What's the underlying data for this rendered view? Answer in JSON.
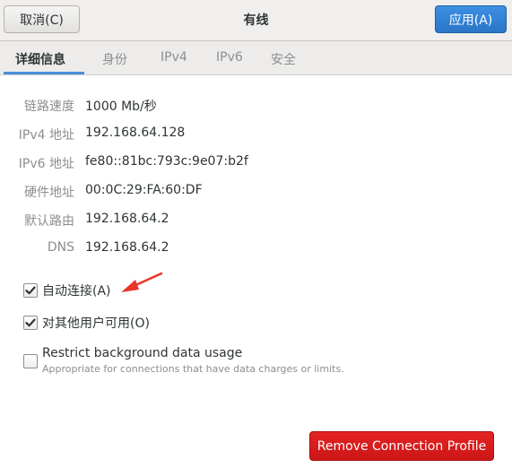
{
  "header": {
    "cancel_label": "取消(C)",
    "title": "有线",
    "apply_label": "应用(A)"
  },
  "tabs": [
    {
      "label": "详细信息",
      "active": true
    },
    {
      "label": "身份",
      "active": false
    },
    {
      "label": "IPv4",
      "active": false
    },
    {
      "label": "IPv6",
      "active": false
    },
    {
      "label": "安全",
      "active": false
    }
  ],
  "details": [
    {
      "label": "链路速度",
      "value": "1000 Mb/秒"
    },
    {
      "label": "IPv4 地址",
      "value": "192.168.64.128"
    },
    {
      "label": "IPv6 地址",
      "value": "fe80::81bc:793c:9e07:b2f"
    },
    {
      "label": "硬件地址",
      "value": "00:0C:29:FA:60:DF"
    },
    {
      "label": "默认路由",
      "value": "192.168.64.2"
    },
    {
      "label": "DNS",
      "value": "192.168.64.2"
    }
  ],
  "options": {
    "auto_connect": {
      "label": "自动连接(A)",
      "checked": true
    },
    "all_users": {
      "label": "对其他用户可用(O)",
      "checked": true
    },
    "restrict_bg": {
      "label": "Restrict background data usage",
      "sublabel": "Appropriate for connections that have data charges or limits.",
      "checked": false
    }
  },
  "footer": {
    "remove_label": "Remove Connection Profile"
  },
  "colors": {
    "accent": "#4a90d9",
    "apply": "#2a76c6",
    "destructive": "#cc1616",
    "annotation_arrow": "#e8352b"
  }
}
